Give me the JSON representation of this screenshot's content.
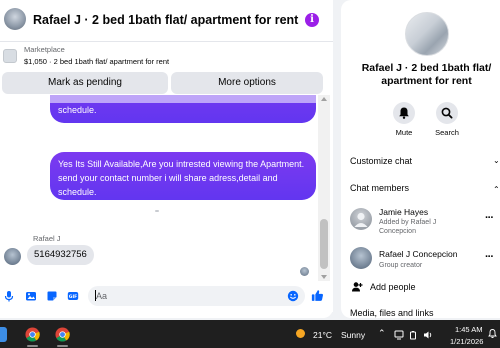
{
  "header": {
    "title": "Rafael J · 2 bed 1bath flat/ apartment for rent",
    "info_glyph": "i",
    "accent_color": "#9b1fe8"
  },
  "marketplace": {
    "label": "Marketplace",
    "item": "$1,050 · 2 bed 1bath flat/ apartment for rent",
    "mark_pending_label": "Mark as pending",
    "more_options_label": "More options"
  },
  "messages": {
    "outgoing_earlier_tail": "schedule.",
    "outgoing_latest": "Yes Its Still Available,Are you intrested viewing the Apartment. send your contact number i will share adress,detail and schedule.",
    "incoming_sender": "Rafael J",
    "incoming_text": "5164932756",
    "bubble_color": "#7b3af0"
  },
  "composer": {
    "placeholder": "Aa",
    "icons": [
      "mic-icon",
      "image-icon",
      "sticker-icon",
      "gif-icon",
      "emoji-icon",
      "thumbs-up-icon"
    ],
    "icon_color": "#0866ff"
  },
  "side_panel": {
    "title": "Rafael J · 2 bed 1bath flat/ apartment for rent",
    "actions": [
      {
        "label": "Mute",
        "icon": "bell-icon"
      },
      {
        "label": "Search",
        "icon": "search-icon"
      }
    ],
    "customize_label": "Customize chat",
    "members_label": "Chat members",
    "members": [
      {
        "name": "Jamie Hayes",
        "sub": "Added by Rafael J Concepcion"
      },
      {
        "name": "Rafael J Concepcion",
        "sub": "Group creator"
      }
    ],
    "add_people_label": "Add people",
    "media_label": "Media, files and links"
  },
  "taskbar": {
    "weather_temp": "21°C",
    "weather_desc": "Sunny",
    "time": "1:45 AM",
    "date": "1/21/2026",
    "apps": [
      "chrome-icon",
      "chrome-icon"
    ]
  }
}
